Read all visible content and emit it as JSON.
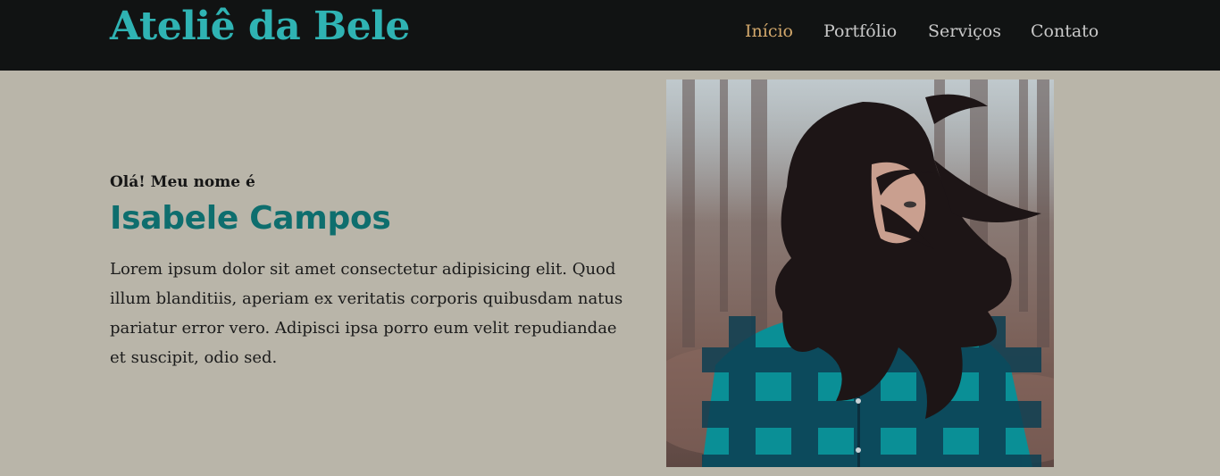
{
  "header": {
    "brand": "Ateliê da Bele",
    "nav": [
      {
        "label": "Início",
        "active": true
      },
      {
        "label": "Portfólio",
        "active": false
      },
      {
        "label": "Serviços",
        "active": false
      },
      {
        "label": "Contato",
        "active": false
      }
    ]
  },
  "hero": {
    "greeting": "Olá! Meu nome é",
    "name": "Isabele Campos",
    "bio": "Lorem ipsum dolor sit amet consectetur adipisicing elit. Quod illum blanditiis, aperiam ex veritatis corporis quibusdam natus pariatur error vero. Adipisci ipsa porro eum velit repudiandae et suscipit, odio sed."
  },
  "colors": {
    "background": "#b9b5a9",
    "header_bg": "#111313",
    "brand": "#2fb3b3",
    "nav_active": "#d4a96c",
    "nav_text": "#c9c9c9",
    "name": "#0e6e6e"
  }
}
